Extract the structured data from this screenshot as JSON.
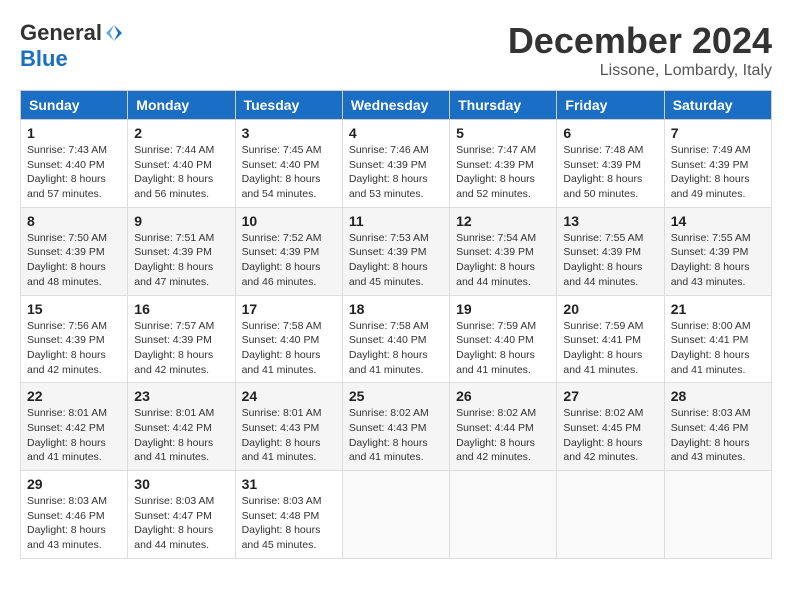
{
  "logo": {
    "general": "General",
    "blue": "Blue"
  },
  "title": "December 2024",
  "location": "Lissone, Lombardy, Italy",
  "weekdays": [
    "Sunday",
    "Monday",
    "Tuesday",
    "Wednesday",
    "Thursday",
    "Friday",
    "Saturday"
  ],
  "weeks": [
    [
      {
        "day": "1",
        "info": "Sunrise: 7:43 AM\nSunset: 4:40 PM\nDaylight: 8 hours and 57 minutes."
      },
      {
        "day": "2",
        "info": "Sunrise: 7:44 AM\nSunset: 4:40 PM\nDaylight: 8 hours and 56 minutes."
      },
      {
        "day": "3",
        "info": "Sunrise: 7:45 AM\nSunset: 4:40 PM\nDaylight: 8 hours and 54 minutes."
      },
      {
        "day": "4",
        "info": "Sunrise: 7:46 AM\nSunset: 4:39 PM\nDaylight: 8 hours and 53 minutes."
      },
      {
        "day": "5",
        "info": "Sunrise: 7:47 AM\nSunset: 4:39 PM\nDaylight: 8 hours and 52 minutes."
      },
      {
        "day": "6",
        "info": "Sunrise: 7:48 AM\nSunset: 4:39 PM\nDaylight: 8 hours and 50 minutes."
      },
      {
        "day": "7",
        "info": "Sunrise: 7:49 AM\nSunset: 4:39 PM\nDaylight: 8 hours and 49 minutes."
      }
    ],
    [
      {
        "day": "8",
        "info": "Sunrise: 7:50 AM\nSunset: 4:39 PM\nDaylight: 8 hours and 48 minutes."
      },
      {
        "day": "9",
        "info": "Sunrise: 7:51 AM\nSunset: 4:39 PM\nDaylight: 8 hours and 47 minutes."
      },
      {
        "day": "10",
        "info": "Sunrise: 7:52 AM\nSunset: 4:39 PM\nDaylight: 8 hours and 46 minutes."
      },
      {
        "day": "11",
        "info": "Sunrise: 7:53 AM\nSunset: 4:39 PM\nDaylight: 8 hours and 45 minutes."
      },
      {
        "day": "12",
        "info": "Sunrise: 7:54 AM\nSunset: 4:39 PM\nDaylight: 8 hours and 44 minutes."
      },
      {
        "day": "13",
        "info": "Sunrise: 7:55 AM\nSunset: 4:39 PM\nDaylight: 8 hours and 44 minutes."
      },
      {
        "day": "14",
        "info": "Sunrise: 7:55 AM\nSunset: 4:39 PM\nDaylight: 8 hours and 43 minutes."
      }
    ],
    [
      {
        "day": "15",
        "info": "Sunrise: 7:56 AM\nSunset: 4:39 PM\nDaylight: 8 hours and 42 minutes."
      },
      {
        "day": "16",
        "info": "Sunrise: 7:57 AM\nSunset: 4:39 PM\nDaylight: 8 hours and 42 minutes."
      },
      {
        "day": "17",
        "info": "Sunrise: 7:58 AM\nSunset: 4:40 PM\nDaylight: 8 hours and 41 minutes."
      },
      {
        "day": "18",
        "info": "Sunrise: 7:58 AM\nSunset: 4:40 PM\nDaylight: 8 hours and 41 minutes."
      },
      {
        "day": "19",
        "info": "Sunrise: 7:59 AM\nSunset: 4:40 PM\nDaylight: 8 hours and 41 minutes."
      },
      {
        "day": "20",
        "info": "Sunrise: 7:59 AM\nSunset: 4:41 PM\nDaylight: 8 hours and 41 minutes."
      },
      {
        "day": "21",
        "info": "Sunrise: 8:00 AM\nSunset: 4:41 PM\nDaylight: 8 hours and 41 minutes."
      }
    ],
    [
      {
        "day": "22",
        "info": "Sunrise: 8:01 AM\nSunset: 4:42 PM\nDaylight: 8 hours and 41 minutes."
      },
      {
        "day": "23",
        "info": "Sunrise: 8:01 AM\nSunset: 4:42 PM\nDaylight: 8 hours and 41 minutes."
      },
      {
        "day": "24",
        "info": "Sunrise: 8:01 AM\nSunset: 4:43 PM\nDaylight: 8 hours and 41 minutes."
      },
      {
        "day": "25",
        "info": "Sunrise: 8:02 AM\nSunset: 4:43 PM\nDaylight: 8 hours and 41 minutes."
      },
      {
        "day": "26",
        "info": "Sunrise: 8:02 AM\nSunset: 4:44 PM\nDaylight: 8 hours and 42 minutes."
      },
      {
        "day": "27",
        "info": "Sunrise: 8:02 AM\nSunset: 4:45 PM\nDaylight: 8 hours and 42 minutes."
      },
      {
        "day": "28",
        "info": "Sunrise: 8:03 AM\nSunset: 4:46 PM\nDaylight: 8 hours and 43 minutes."
      }
    ],
    [
      {
        "day": "29",
        "info": "Sunrise: 8:03 AM\nSunset: 4:46 PM\nDaylight: 8 hours and 43 minutes."
      },
      {
        "day": "30",
        "info": "Sunrise: 8:03 AM\nSunset: 4:47 PM\nDaylight: 8 hours and 44 minutes."
      },
      {
        "day": "31",
        "info": "Sunrise: 8:03 AM\nSunset: 4:48 PM\nDaylight: 8 hours and 45 minutes."
      },
      {
        "day": "",
        "info": ""
      },
      {
        "day": "",
        "info": ""
      },
      {
        "day": "",
        "info": ""
      },
      {
        "day": "",
        "info": ""
      }
    ]
  ]
}
